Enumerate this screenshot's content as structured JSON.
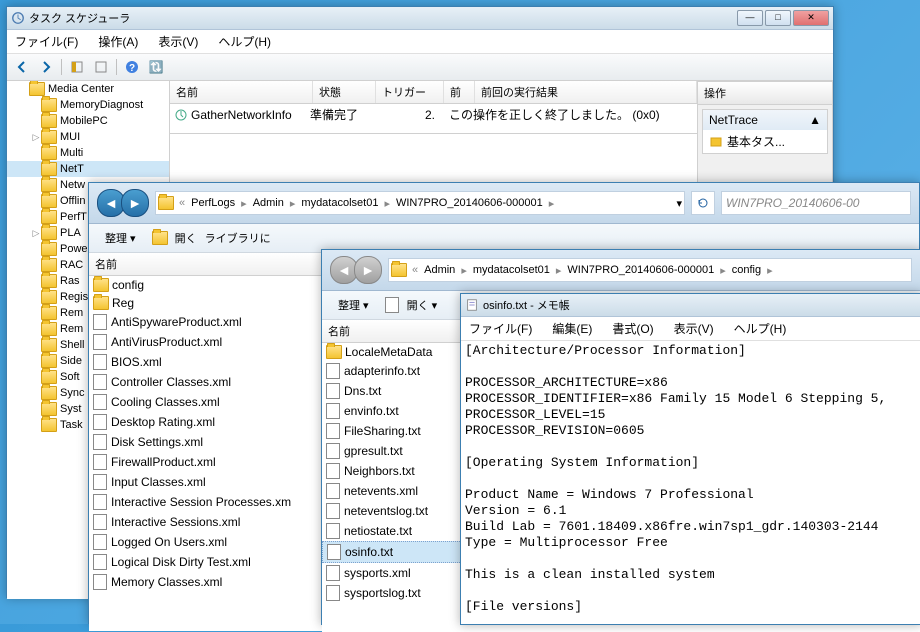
{
  "task_scheduler": {
    "title": "タスク スケジューラ",
    "menu": [
      "ファイル(F)",
      "操作(A)",
      "表示(V)",
      "ヘルプ(H)"
    ],
    "tree": [
      {
        "name": "Media Center",
        "expanded": true,
        "indent": 1
      },
      {
        "name": "MemoryDiagnost",
        "indent": 2
      },
      {
        "name": "MobilePC",
        "indent": 2
      },
      {
        "name": "MUI",
        "indent": 2,
        "expander": "▷"
      },
      {
        "name": "Multi",
        "indent": 2
      },
      {
        "name": "NetT",
        "indent": 2,
        "sel": true
      },
      {
        "name": "Netw",
        "indent": 2
      },
      {
        "name": "Offlin",
        "indent": 2
      },
      {
        "name": "PerfT",
        "indent": 2
      },
      {
        "name": "PLA",
        "indent": 2,
        "expander": "▷"
      },
      {
        "name": "Powe",
        "indent": 2
      },
      {
        "name": "RAC",
        "indent": 2
      },
      {
        "name": "Ras",
        "indent": 2
      },
      {
        "name": "Regis",
        "indent": 2
      },
      {
        "name": "Rem",
        "indent": 2
      },
      {
        "name": "Rem",
        "indent": 2
      },
      {
        "name": "Shell",
        "indent": 2
      },
      {
        "name": "Side",
        "indent": 2
      },
      {
        "name": "Soft",
        "indent": 2
      },
      {
        "name": "Sync",
        "indent": 2
      },
      {
        "name": "Syst",
        "indent": 2
      },
      {
        "name": "Task",
        "indent": 2
      }
    ],
    "list_cols": {
      "name": "名前",
      "state": "状態",
      "trigger": "トリガー",
      "next": "前",
      "result": "前回の実行結果"
    },
    "list_row": {
      "name": "GatherNetworkInfo",
      "state": "準備完了",
      "next": "2.",
      "result": "この操作を正しく終了しました。 (0x0)"
    },
    "actions_title": "操作",
    "actions_group": "NetTrace",
    "actions_item": "基本タス..."
  },
  "explorer1": {
    "crumbs": [
      "PerfLogs",
      "Admin",
      "mydatacolset01",
      "WIN7PRO_20140606-000001"
    ],
    "addr_right": "WIN7PRO_20140606-00",
    "organize": "整理 ▾",
    "open": "開く",
    "library": "ライブラリに",
    "col_name": "名前",
    "items": [
      {
        "name": "config",
        "type": "folder"
      },
      {
        "name": "Reg",
        "type": "folder"
      },
      {
        "name": "AntiSpywareProduct.xml",
        "type": "xml"
      },
      {
        "name": "AntiVirusProduct.xml",
        "type": "xml"
      },
      {
        "name": "BIOS.xml",
        "type": "xml"
      },
      {
        "name": "Controller Classes.xml",
        "type": "xml"
      },
      {
        "name": "Cooling Classes.xml",
        "type": "xml"
      },
      {
        "name": "Desktop Rating.xml",
        "type": "xml"
      },
      {
        "name": "Disk Settings.xml",
        "type": "xml"
      },
      {
        "name": "FirewallProduct.xml",
        "type": "xml"
      },
      {
        "name": "Input Classes.xml",
        "type": "xml"
      },
      {
        "name": "Interactive Session Processes.xm",
        "type": "xml"
      },
      {
        "name": "Interactive Sessions.xml",
        "type": "xml"
      },
      {
        "name": "Logged On Users.xml",
        "type": "xml"
      },
      {
        "name": "Logical Disk Dirty Test.xml",
        "type": "xml"
      },
      {
        "name": "Memory Classes.xml",
        "type": "xml"
      }
    ]
  },
  "explorer2": {
    "crumbs": [
      "Admin",
      "mydatacolset01",
      "WIN7PRO_20140606-000001",
      "config"
    ],
    "organize": "整理 ▾",
    "open": "開く ▾",
    "col_name": "名前",
    "items": [
      {
        "name": "LocaleMetaData",
        "type": "folder"
      },
      {
        "name": "adapterinfo.txt",
        "type": "txt"
      },
      {
        "name": "Dns.txt",
        "type": "txt"
      },
      {
        "name": "envinfo.txt",
        "type": "txt"
      },
      {
        "name": "FileSharing.txt",
        "type": "txt"
      },
      {
        "name": "gpresult.txt",
        "type": "txt"
      },
      {
        "name": "Neighbors.txt",
        "type": "txt"
      },
      {
        "name": "netevents.xml",
        "type": "xml"
      },
      {
        "name": "neteventslog.txt",
        "type": "txt"
      },
      {
        "name": "netiostate.txt",
        "type": "txt"
      },
      {
        "name": "osinfo.txt",
        "type": "txt",
        "sel": true
      },
      {
        "name": "sysports.xml",
        "type": "xml"
      },
      {
        "name": "sysportslog.txt",
        "type": "txt"
      }
    ]
  },
  "notepad": {
    "title": "osinfo.txt - メモ帳",
    "menu": [
      "ファイル(F)",
      "編集(E)",
      "書式(O)",
      "表示(V)",
      "ヘルプ(H)"
    ],
    "content": "[Architecture/Processor Information]\n\nPROCESSOR_ARCHITECTURE=x86\nPROCESSOR_IDENTIFIER=x86 Family 15 Model 6 Stepping 5,\nPROCESSOR_LEVEL=15\nPROCESSOR_REVISION=0605\n\n[Operating System Information]\n\nProduct Name = Windows 7 Professional\nVersion = 6.1\nBuild Lab = 7601.18409.x86fre.win7sp1_gdr.140303-2144\nType = Multiprocessor Free\n\nThis is a clean installed system\n\n[File versions]"
  }
}
